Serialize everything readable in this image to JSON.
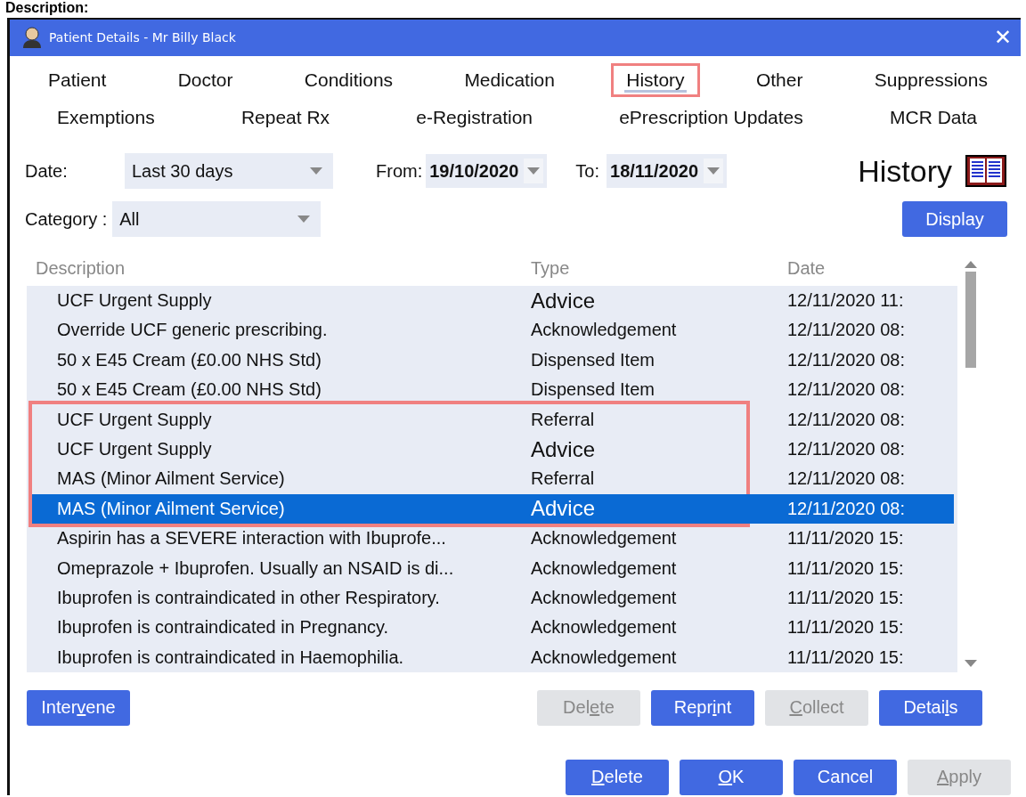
{
  "heading": "Description:",
  "window": {
    "title": "Patient Details - Mr  Billy Black",
    "close": "✕"
  },
  "tabs": [
    [
      {
        "label": "Patient",
        "selected": false,
        "outlined": false
      },
      {
        "label": "Doctor",
        "selected": false,
        "outlined": false
      },
      {
        "label": "Conditions",
        "selected": false,
        "outlined": false
      },
      {
        "label": "Medication",
        "selected": false,
        "outlined": false
      },
      {
        "label": "History",
        "selected": true,
        "outlined": true
      },
      {
        "label": "Other",
        "selected": false,
        "outlined": false
      },
      {
        "label": "Suppressions",
        "selected": false,
        "outlined": false
      }
    ],
    [
      {
        "label": "Exemptions",
        "selected": false,
        "outlined": false
      },
      {
        "label": "Repeat Rx",
        "selected": false,
        "outlined": false
      },
      {
        "label": "e-Registration",
        "selected": false,
        "outlined": false
      },
      {
        "label": "ePrescription Updates",
        "selected": false,
        "outlined": false
      },
      {
        "label": "MCR Data",
        "selected": false,
        "outlined": false
      }
    ]
  ],
  "filters": {
    "date_label": "Date:",
    "date_value": "Last 30 days",
    "from_label": "From:",
    "from_value": "19/10/2020",
    "to_label": "To:",
    "to_value": "18/11/2020",
    "category_label": "Category :",
    "category_value": "All"
  },
  "section_title": "History",
  "display_button": "Display",
  "table": {
    "columns": [
      "Description",
      "Type",
      "Date"
    ],
    "rows": [
      {
        "description": "UCF Urgent Supply",
        "type": "Advice",
        "kind": "large",
        "date": "12/11/2020 11:",
        "selected": false,
        "outlined": false
      },
      {
        "description": "Override UCF generic prescribing.",
        "type": "Acknowledgement",
        "kind": "normal",
        "date": "12/11/2020 08:",
        "selected": false,
        "outlined": false
      },
      {
        "description": "50 x E45 Cream (£0.00 NHS Std)",
        "type": "Dispensed Item",
        "kind": "normal",
        "date": "12/11/2020 08:",
        "selected": false,
        "outlined": false
      },
      {
        "description": "50 x E45 Cream (£0.00 NHS Std)",
        "type": "Dispensed Item",
        "kind": "normal",
        "date": "12/11/2020 08:",
        "selected": false,
        "outlined": false
      },
      {
        "description": "UCF Urgent Supply",
        "type": "Referral",
        "kind": "normal",
        "date": "12/11/2020 08:",
        "selected": false,
        "outlined": true
      },
      {
        "description": "UCF Urgent Supply",
        "type": "Advice",
        "kind": "large",
        "date": "12/11/2020 08:",
        "selected": false,
        "outlined": true
      },
      {
        "description": "MAS (Minor Ailment Service)",
        "type": "Referral",
        "kind": "normal",
        "date": "12/11/2020 08:",
        "selected": false,
        "outlined": true
      },
      {
        "description": "MAS (Minor Ailment Service)",
        "type": "Advice",
        "kind": "large",
        "date": "12/11/2020 08:",
        "selected": true,
        "outlined": true
      },
      {
        "description": "Aspirin has a SEVERE interaction with Ibuprofe...",
        "type": "Acknowledgement",
        "kind": "normal",
        "date": "11/11/2020 15:",
        "selected": false,
        "outlined": false
      },
      {
        "description": "Omeprazole + Ibuprofen. Usually an NSAID is di...",
        "type": "Acknowledgement",
        "kind": "normal",
        "date": "11/11/2020 15:",
        "selected": false,
        "outlined": false
      },
      {
        "description": "Ibuprofen is contraindicated in other Respiratory.",
        "type": "Acknowledgement",
        "kind": "normal",
        "date": "11/11/2020 15:",
        "selected": false,
        "outlined": false
      },
      {
        "description": "Ibuprofen is contraindicated in Pregnancy.",
        "type": "Acknowledgement",
        "kind": "normal",
        "date": "11/11/2020 15:",
        "selected": false,
        "outlined": false
      },
      {
        "description": "Ibuprofen is contraindicated in Haemophilia.",
        "type": "Acknowledgement",
        "kind": "normal",
        "date": "11/11/2020 15:",
        "selected": false,
        "outlined": false
      }
    ]
  },
  "list_buttons_left": [
    {
      "label": {
        "pre": "Inter",
        "key": "v",
        "post": "ene"
      },
      "disabled": false
    }
  ],
  "list_buttons_right": [
    {
      "label": {
        "pre": "Del",
        "key": "e",
        "post": "te"
      },
      "disabled": true
    },
    {
      "label": {
        "pre": "Repr",
        "key": "i",
        "post": "nt"
      },
      "disabled": false
    },
    {
      "label": {
        "key": "C",
        "post": "ollect"
      },
      "disabled": true
    },
    {
      "label": {
        "pre": "Detai",
        "key": "l",
        "post": "s"
      },
      "disabled": false
    }
  ],
  "dialog_buttons": [
    {
      "label": {
        "key": "D",
        "post": "elete"
      },
      "disabled": false
    },
    {
      "label": {
        "key": "O",
        "post": "K"
      },
      "disabled": false
    },
    {
      "label": {
        "pre": "Cancel"
      },
      "disabled": false
    },
    {
      "label": {
        "key": "A",
        "post": "pply"
      },
      "disabled": true
    }
  ]
}
